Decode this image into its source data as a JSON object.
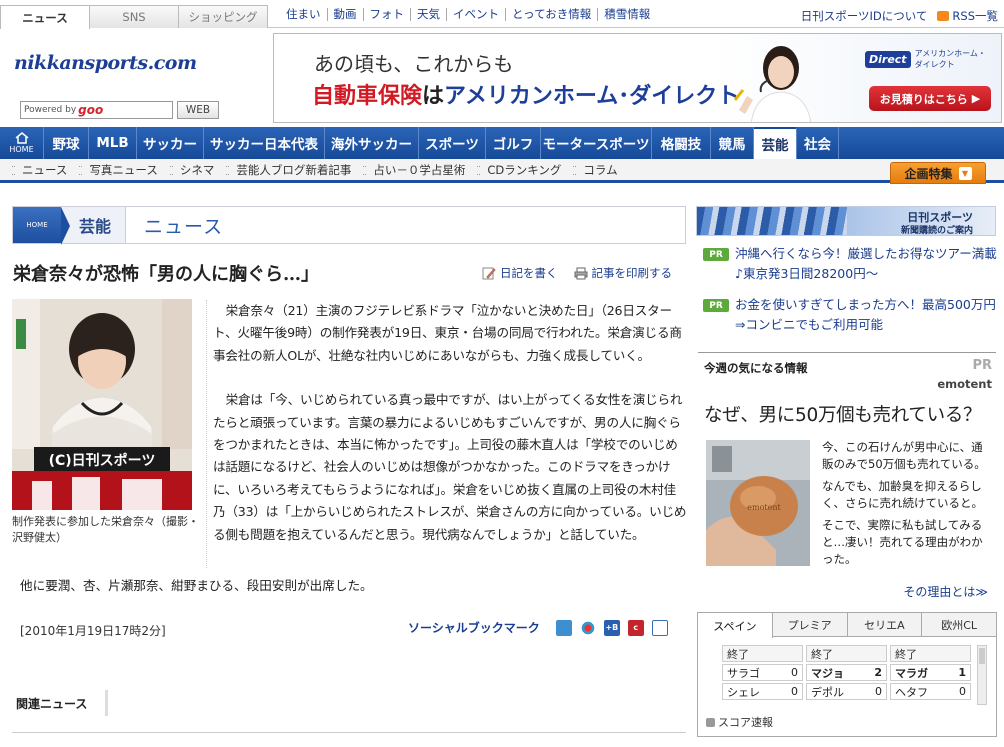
{
  "top_tabs": [
    "ニュース",
    "SNS",
    "ショッピング"
  ],
  "top_links": [
    "住まい",
    "動画",
    "フォト",
    "天気",
    "イベント",
    "とっておき情報",
    "積雪情報"
  ],
  "right_links": {
    "id_about": "日刊スポーツIDについて",
    "rss": "RSS一覧"
  },
  "header": {
    "logo": "nikkansports.com",
    "search_powered": "Powered by",
    "search_brand": "goo",
    "web_button": "WEB"
  },
  "ad": {
    "line1": "あの頃も、これからも",
    "line2_red": "自動車保険",
    "line2_mid": "は",
    "line2_blue": "アメリカンホーム･ダイレクト",
    "brand_logo": "Direct",
    "brand_name": "アメリカンホーム・ダイレクト",
    "cta": "お見積りはこちら"
  },
  "main_nav": {
    "home": "HOME",
    "items": [
      "野球",
      "MLB",
      "サッカー",
      "サッカー日本代表",
      "海外サッカー",
      "スポーツ",
      "ゴルフ",
      "モータースポーツ",
      "格闘技",
      "競馬",
      "芸能",
      "社会"
    ],
    "active": "芸能"
  },
  "sub_nav": [
    "ニュース",
    "写真ニュース",
    "シネマ",
    "芸能人ブログ新着記事",
    "占い－０学占星術",
    "CDランキング",
    "コラム"
  ],
  "special_button": "企画特集",
  "breadcrumb": {
    "home": "HOME",
    "section": "芸能",
    "page": "ニュース"
  },
  "article": {
    "headline": "栄倉奈々が恐怖「男の人に胸ぐら…」",
    "tool_diary": "日記を書く",
    "tool_print": "記事を印刷する",
    "photo_watermark": "(C)日刊スポーツ",
    "caption": "制作発表に参加した栄倉奈々（撮影・沢野健太）",
    "paragraphs": [
      "栄倉奈々（21）主演のフジテレビ系ドラマ「泣かないと決めた日」（26日スタート、火曜午後9時）の制作発表が19日、東京・台場の同局で行われた。栄倉演じる商事会社の新人OLが、壮絶な社内いじめにあいながらも、力強く成長していく。",
      "栄倉は「今、いじめられている真っ最中ですが、はい上がってくる女性を演じられたらと頑張っています。言葉の暴力によるいじめもすごいんですが、男の人に胸ぐらをつかまれたときは、本当に怖かったです」。上司役の藤木直人は「学校でのいじめは話題になるけど、社会人のいじめは想像がつかなかった。このドラマをきっかけに、いろいろ考えてもらうようになれば」。栄倉をいじめ抜く直属の上司役の木村佳乃（33）は「上からいじめられたストレスが、栄倉さんの方に向かっている。いじめる側も問題を抱えているんだと思う。現代病なんでしょうか」と話していた。"
    ],
    "extra": "他に要潤、杏、片瀬那奈、紺野まひる、段田安則が出席した。",
    "date": "[2010年1月19日17時2分]",
    "social_label": "ソーシャルブックマーク",
    "related": "関連ニュース"
  },
  "right": {
    "banner_title": "日刊スポーツ",
    "banner_sub": "新聞購読のご案内",
    "pr_items": [
      {
        "tag": "PR",
        "text": "沖縄へ行くなら今！厳選したお得なツアー満載♪東京発3日間28200円～"
      },
      {
        "tag": "PR",
        "text": "お金を使いすぎてしまった方へ！最高500万円⇒コンビニでもご利用可能"
      }
    ],
    "feature": {
      "heading": "今週の気になる情報",
      "pr": "PR",
      "sponsor": "emotent",
      "title": "なぜ、男に50万個も売れている？",
      "body": [
        "今、この石けんが男中心に、通販のみで50万個も売れている。",
        "なんでも、加齢臭を抑えるらしく、さらに売れ続けていると。",
        "そこで、実際に私も試してみると…凄い！売れてる理由がわかった。"
      ],
      "more": "その理由とは≫"
    },
    "scores": {
      "tabs": [
        "スペイン",
        "プレミア",
        "セリエA",
        "欧州CL"
      ],
      "active_tab": "スペイン",
      "games": [
        {
          "status": "終了",
          "home": "サラゴ",
          "home_score": "0",
          "away": "シェレ",
          "away_score": "0"
        },
        {
          "status": "終了",
          "home": "マジョ",
          "home_score": "2",
          "away": "デポル",
          "away_score": "0"
        },
        {
          "status": "終了",
          "home": "マラガ",
          "home_score": "1",
          "away": "ヘタフ",
          "away_score": "0"
        }
      ],
      "footer": "スコア速報"
    }
  }
}
